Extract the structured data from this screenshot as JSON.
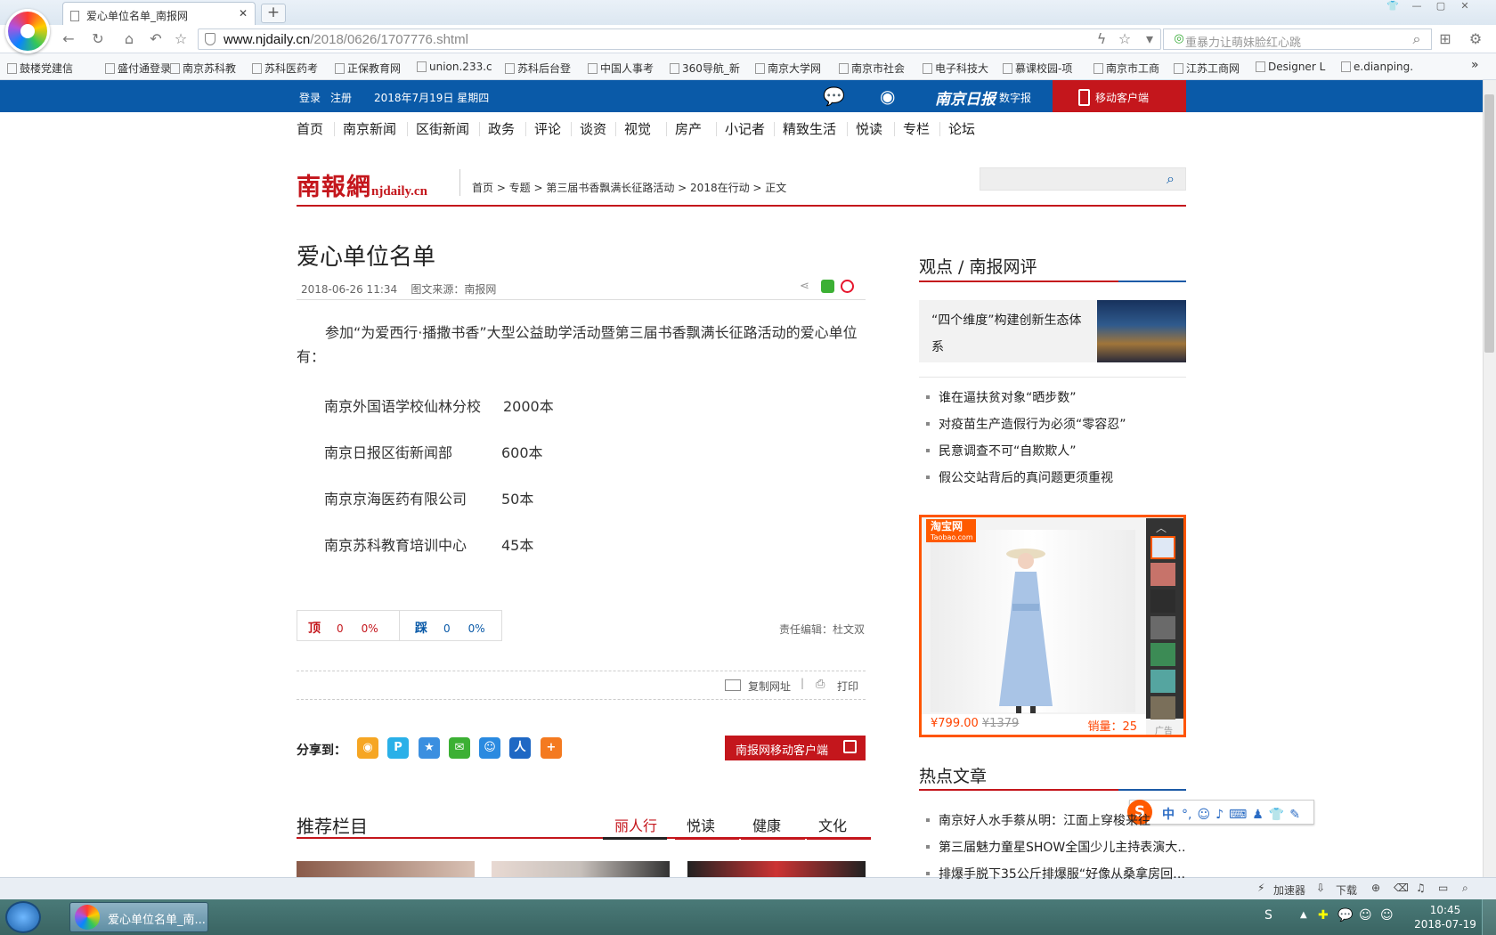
{
  "browser": {
    "tab_title": "爱心单位名单_南报网",
    "url_host": "www.njdaily.cn",
    "url_path": "/2018/0626/1707776.shtml",
    "search_placeholder": "重暴力让萌妹脸红心跳",
    "bookmarks": [
      "鼓楼党建信",
      "盛付通登录",
      "南京苏科教",
      "苏科医药考",
      "正保教育网",
      "union.233.c",
      "苏科后台登",
      "中国人事考",
      "360导航_新",
      "南京大学网",
      "南京市社会",
      "电子科技大",
      "慕课校园-项",
      "南京市工商",
      "江苏工商网",
      "Designer L",
      "e.dianping."
    ]
  },
  "site": {
    "login": "登录",
    "register": "注册",
    "date": "2018年7月19日 星期四",
    "digital": "数字报",
    "mobile": "移动客户端",
    "brand_cn": "南京日报",
    "nav": [
      "首页",
      "南京新闻",
      "区街新闻",
      "政务",
      "评论",
      "谈资",
      "视觉",
      "房产",
      "小记者",
      "精致生活",
      "悦读",
      "专栏",
      "论坛"
    ],
    "logo_cn": "南報網",
    "logo_en": "njdaily.cn",
    "breadcrumb": "首页 > 专题 > 第三届书香飘满长征路活动 > 2018在行动 > 正文"
  },
  "article": {
    "title": "爱心单位名单",
    "date": "2018-06-26 11:34",
    "source": "图文来源：南报网",
    "intro": "参加“为爱西行·播撒书香”大型公益助学活动暨第三届书香飘满长征路活动的爱心单位有：",
    "donors": [
      {
        "name": "南京外国语学校仙林分校",
        "amount": "2000本"
      },
      {
        "name": "南京日报区街新闻部",
        "amount": "600本"
      },
      {
        "name": "南京京海医药有限公司",
        "amount": "50本"
      },
      {
        "name": "南京苏科教育培训中心",
        "amount": "45本"
      }
    ],
    "vote_up": {
      "label": "顶",
      "count": "0",
      "pct": "0%"
    },
    "vote_down": {
      "label": "踩",
      "count": "0",
      "pct": "0%"
    },
    "editor": "责任编辑：杜文双",
    "copy_url": "复制网址",
    "print": "打印",
    "share_label": "分享到：",
    "app_button": "南报网移动客户端"
  },
  "recommend": {
    "title": "推荐栏目",
    "tabs": [
      "丽人行",
      "悦读",
      "健康",
      "文化"
    ]
  },
  "sidebar": {
    "opinion_title": "观点 / 南报网评",
    "feature_text": "“四个维度”构建创新生态体系",
    "opinion_items": [
      "谁在逼扶贫对象“晒步数”",
      "对疫苗生产造假行为必须“零容忍”",
      "民意调查不可“自欺欺人”",
      "假公交站背后的真问题更须重视"
    ],
    "ad": {
      "logo": "淘宝网",
      "logo_sub": "Taobao.com",
      "price": "¥799.00",
      "old_price": "¥1379",
      "sales": "销量：25",
      "tag": "广告"
    },
    "hot_title": "热点文章",
    "hot_items": [
      "南京好人水手蔡从明：江面上穿梭来往",
      "第三届魅力童星SHOW全国少儿主持表演大…",
      "排爆手脱下35公斤排爆服“好像从桑拿房回…"
    ]
  },
  "ime": {
    "mode": "中"
  },
  "status": {
    "accelerator": "加速器",
    "download": "下载"
  },
  "taskbar": {
    "task": "爱心单位名单_南...",
    "time": "10:45",
    "date": "2018-07-19"
  },
  "colors": {
    "brand_red": "#c4161c",
    "nav_blue": "#0a5aa8",
    "ad_orange": "#ff5500"
  }
}
